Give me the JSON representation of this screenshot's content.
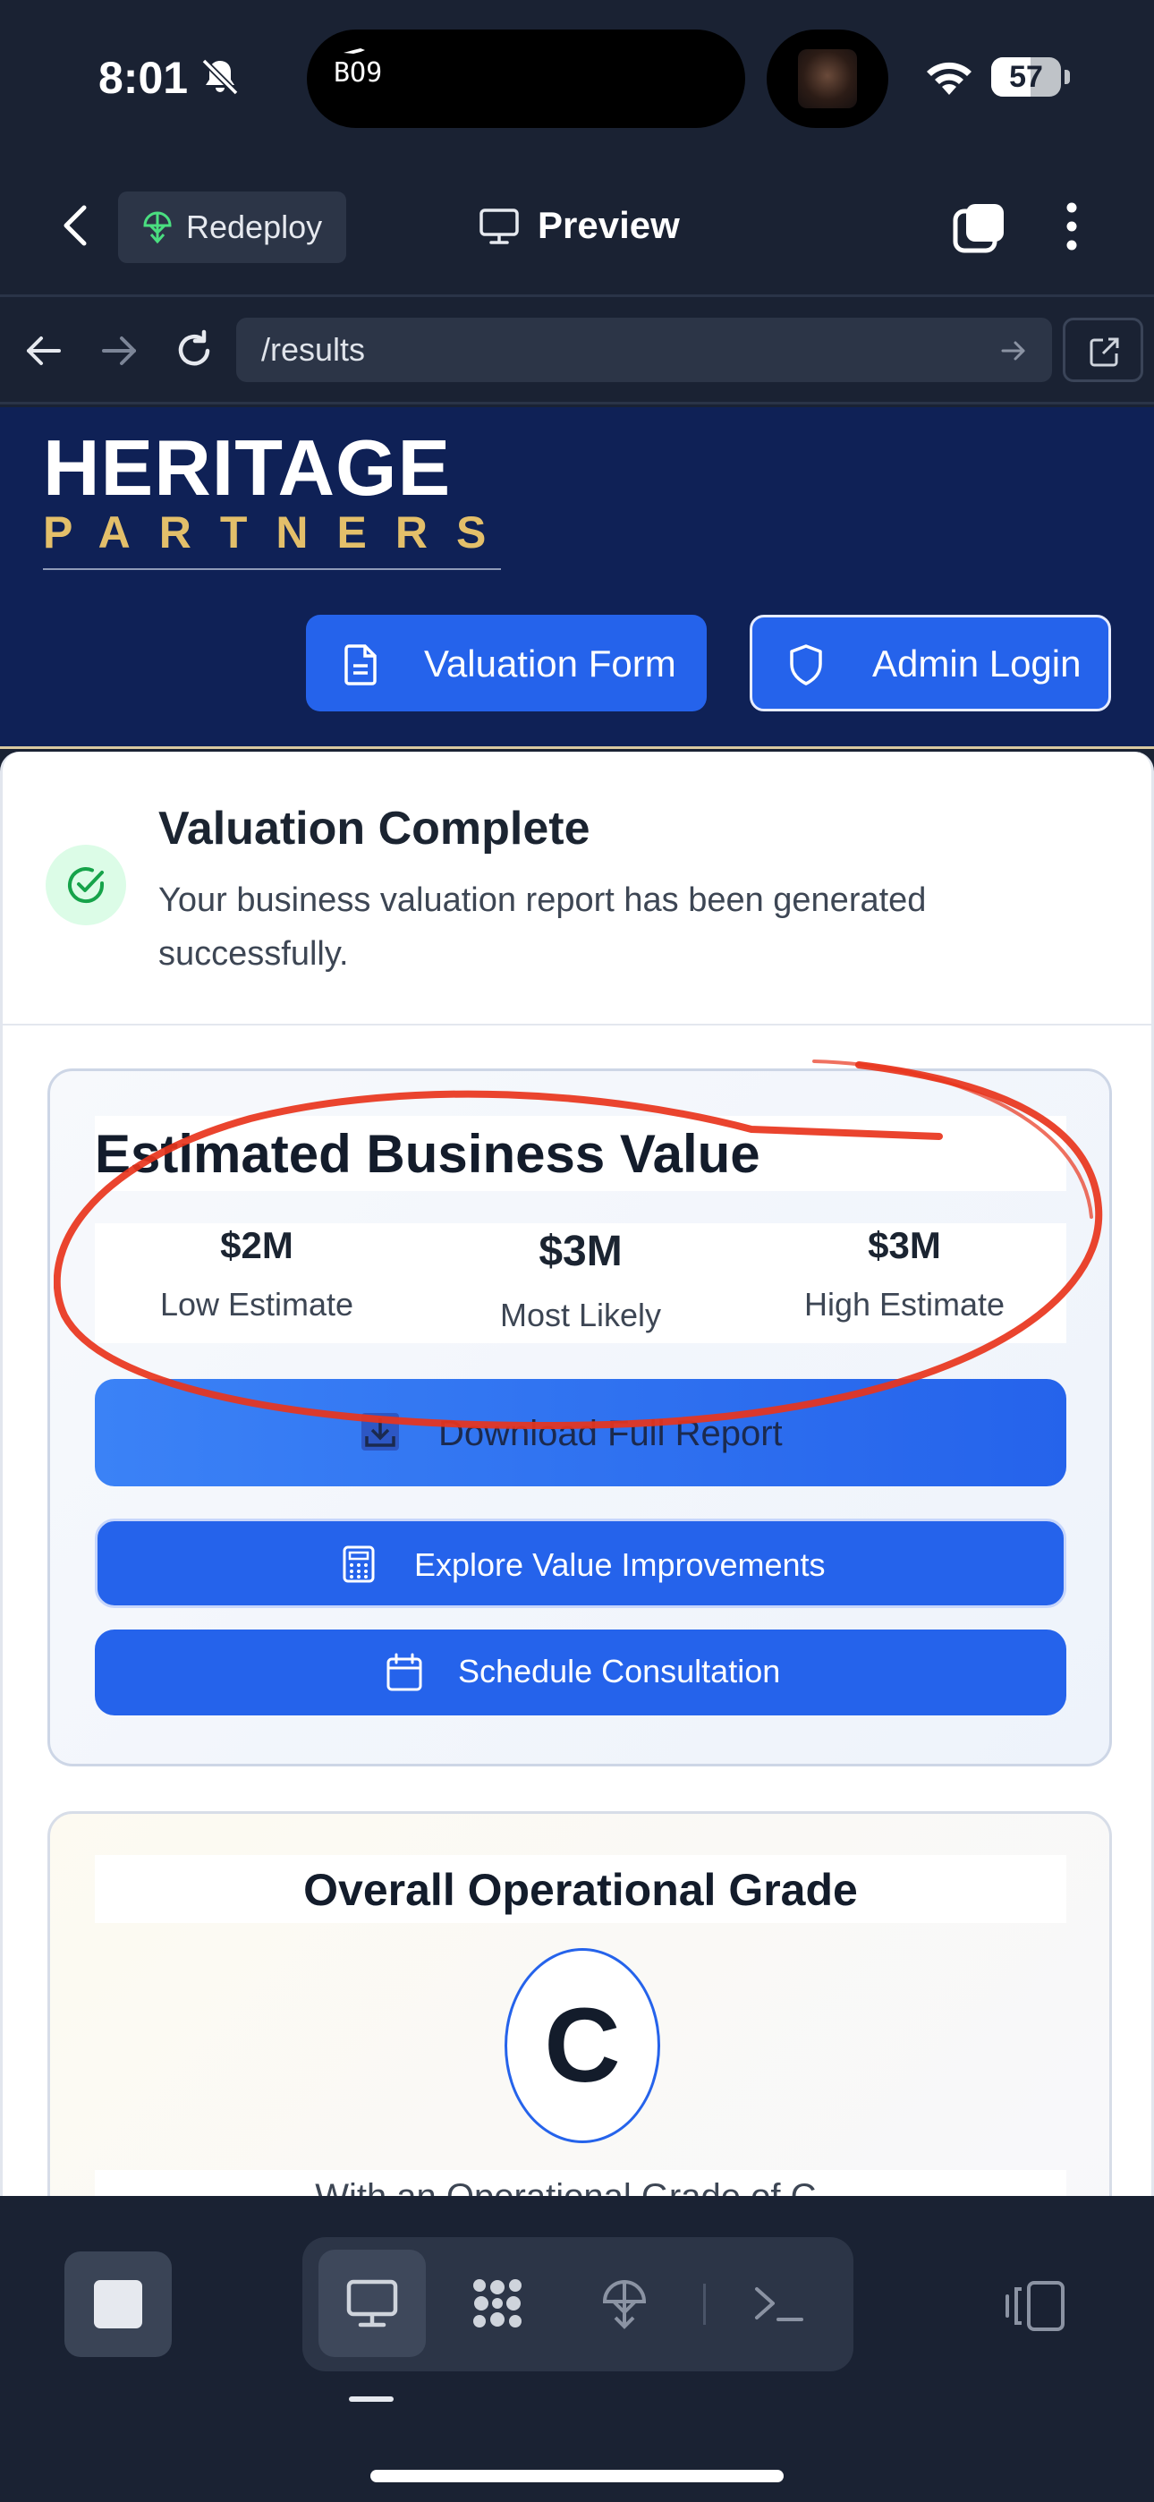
{
  "status_bar": {
    "time": "8:01",
    "island_label": "BO9",
    "battery_level": "57",
    "battery_fraction": 0.57
  },
  "app_header": {
    "redeploy_label": "Redeploy",
    "title": "Preview"
  },
  "url_bar": {
    "url": "/results"
  },
  "site_header": {
    "logo_line1": "HERITAGE",
    "logo_line2": "PARTNERS",
    "valuation_form_label": "Valuation Form",
    "admin_login_label": "Admin Login"
  },
  "complete": {
    "title": "Valuation Complete",
    "subtitle": "Your business valuation report has been generated successfully."
  },
  "value_card": {
    "title": "Estimated Business Value",
    "estimates": [
      {
        "value": "$2M",
        "label": "Low Estimate"
      },
      {
        "value": "$3M",
        "label": "Most Likely"
      },
      {
        "value": "$3M",
        "label": "High Estimate"
      }
    ],
    "download_label": "Download Full Report",
    "explore_label": "Explore Value Improvements",
    "schedule_label": "Schedule Consultation"
  },
  "grade_card": {
    "title": "Overall Operational Grade",
    "grade": "C",
    "note": "With an Operational Grade of C..."
  },
  "colors": {
    "accent": "#2563eb",
    "header_navy": "#0f2156",
    "logo_gold": "#e3bf6a",
    "annotation_red": "#e8341c",
    "success_green": "#16a34a"
  },
  "icons": {
    "status": [
      "bell-slash-icon",
      "wifi-icon",
      "battery-icon"
    ],
    "toolbar": [
      "stop-icon",
      "desktop-icon",
      "grid-dots-icon",
      "deploy-icon",
      "terminal-icon",
      "devices-icon"
    ]
  }
}
